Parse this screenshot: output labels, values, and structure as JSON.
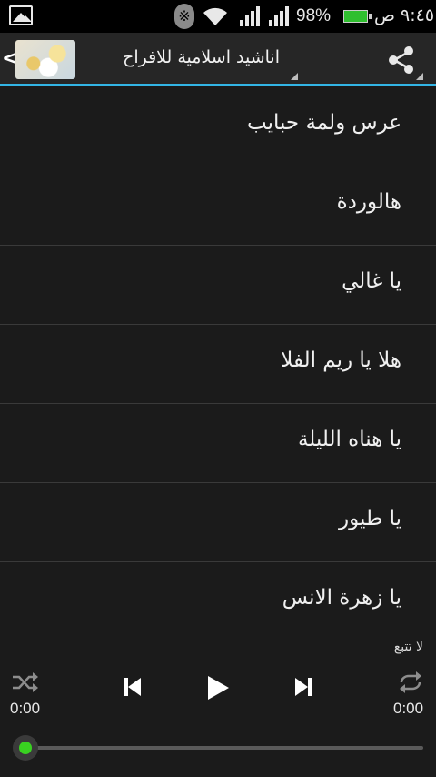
{
  "status_bar": {
    "battery_percent": "98%",
    "time": "٩:٤٥ ص",
    "battery_level": 0.98,
    "bluetooth_icon": "bluetooth-icon",
    "wifi_icon": "wifi-icon",
    "signal_icon": "signal-icon",
    "gallery_icon": "image-icon"
  },
  "action_bar": {
    "title": "اناشيد اسلامية للافراح",
    "share_icon": "share-icon",
    "back_icon": "chevron-left-icon",
    "accent_color": "#33b5e5"
  },
  "songs": [
    "عرس ولمة حبايب",
    "هالوردة",
    "يا غالي",
    "هلا يا ريم الفلا",
    "يا هناه الليلة",
    "يا طيور",
    "يا زهرة الانس"
  ],
  "player": {
    "repeat_mode": "لا تتبع",
    "elapsed": "0:00",
    "duration": "0:00",
    "progress": 0,
    "progress_color": "#39d121",
    "shuffle_icon": "shuffle-icon",
    "previous_icon": "skip-previous-icon",
    "play_icon": "play-icon",
    "next_icon": "skip-next-icon",
    "repeat_icon": "repeat-icon"
  }
}
